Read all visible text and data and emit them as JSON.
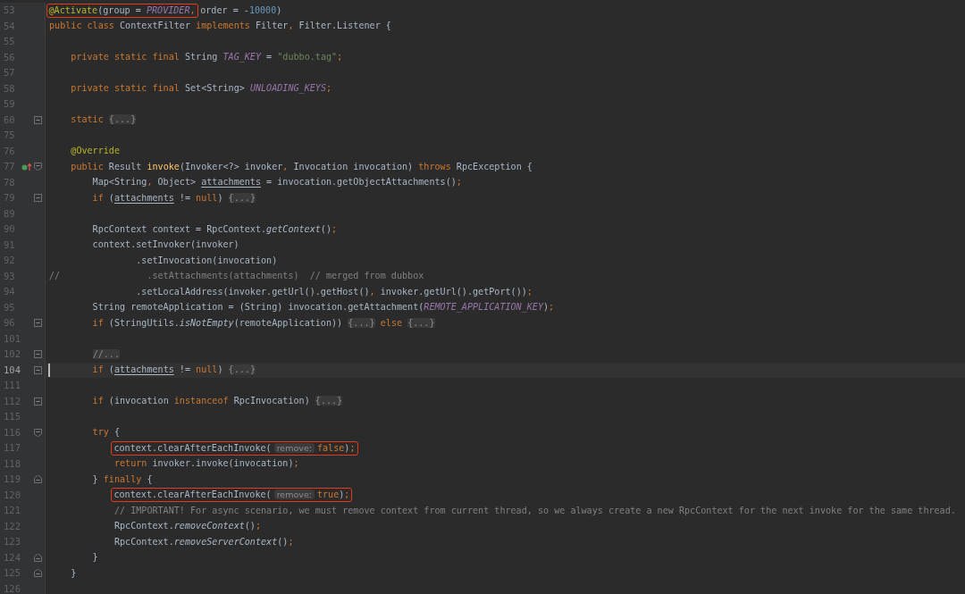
{
  "editor": {
    "lines": [
      {
        "number": "53",
        "current": false,
        "tokens": [
          {
            "text": "@Activate",
            "kind": "annotation",
            "box": true
          },
          {
            "text": "(group = ",
            "box": true
          },
          {
            "text": "PROVIDER",
            "kind": "constant",
            "box": true
          },
          {
            "text": ",",
            "kind": "keyword",
            "box": true
          },
          {
            "text": " order = -"
          },
          {
            "text": "10000",
            "kind": "number"
          },
          {
            "text": ")"
          }
        ]
      },
      {
        "number": "54",
        "current": false,
        "tokens": [
          {
            "text": "public class",
            "kind": "keyword"
          },
          {
            "text": " ContextFilter "
          },
          {
            "text": "implements",
            "kind": "keyword"
          },
          {
            "text": " Filter"
          },
          {
            "text": ",",
            "kind": "keyword"
          },
          {
            "text": " Filter.Listener {"
          }
        ]
      },
      {
        "number": "55",
        "current": false
      },
      {
        "number": "56",
        "current": false,
        "tokens": [
          {
            "text": "    private static final",
            "kind": "keyword"
          },
          {
            "text": " String "
          },
          {
            "text": "TAG_KEY",
            "kind": "constant"
          },
          {
            "text": " = "
          },
          {
            "text": "\"dubbo.tag\"",
            "kind": "string"
          },
          {
            "text": ";",
            "kind": "keyword"
          }
        ]
      },
      {
        "number": "57",
        "current": false
      },
      {
        "number": "58",
        "current": false,
        "tokens": [
          {
            "text": "    private static final",
            "kind": "keyword"
          },
          {
            "text": " Set<String> "
          },
          {
            "text": "UNLOADING_KEYS",
            "kind": "constant"
          },
          {
            "text": ";",
            "kind": "keyword"
          }
        ]
      },
      {
        "number": "59",
        "current": false
      },
      {
        "number": "60",
        "current": false,
        "fold": {
          "kind": "collapsed"
        },
        "tokens": [
          {
            "text": "    static ",
            "kind": "keyword"
          },
          {
            "text": "{...}",
            "kind": "folded"
          }
        ]
      },
      {
        "number": "75",
        "current": false
      },
      {
        "number": "76",
        "current": false,
        "tokens": [
          {
            "text": "    @Override",
            "kind": "annotation"
          }
        ]
      },
      {
        "number": "77",
        "current": false,
        "fold": {
          "kind": "open"
        },
        "gutter_icon": {
          "kind": "override"
        },
        "tokens": [
          {
            "text": "    public",
            "kind": "keyword"
          },
          {
            "text": " Result "
          },
          {
            "text": "invoke",
            "kind": "method"
          },
          {
            "text": "(Invoker<?> invoker"
          },
          {
            "text": ",",
            "kind": "keyword"
          },
          {
            "text": " Invocation invocation) "
          },
          {
            "text": "throws",
            "kind": "keyword"
          },
          {
            "text": " RpcException {"
          }
        ]
      },
      {
        "number": "78",
        "current": false,
        "tokens": [
          {
            "text": "        Map<String"
          },
          {
            "text": ",",
            "kind": "keyword"
          },
          {
            "text": " Object> "
          },
          {
            "text": "attachments",
            "kind": "field"
          },
          {
            "text": " = invocation.getObjectAttachments()"
          },
          {
            "text": ";",
            "kind": "keyword"
          }
        ]
      },
      {
        "number": "79",
        "current": false,
        "fold": {
          "kind": "collapsed"
        },
        "tokens": [
          {
            "text": "        if",
            "kind": "keyword"
          },
          {
            "text": " ("
          },
          {
            "text": "attachments",
            "kind": "field"
          },
          {
            "text": " != "
          },
          {
            "text": "null",
            "kind": "keyword"
          },
          {
            "text": ") "
          },
          {
            "text": "{...}",
            "kind": "folded"
          }
        ]
      },
      {
        "number": "89",
        "current": false
      },
      {
        "number": "90",
        "current": false,
        "tokens": [
          {
            "text": "        RpcContext context = RpcContext."
          },
          {
            "text": "getContext",
            "kind": "static"
          },
          {
            "text": "()"
          },
          {
            "text": ";",
            "kind": "keyword"
          }
        ]
      },
      {
        "number": "91",
        "current": false,
        "tokens": [
          {
            "text": "        context.setInvoker(invoker)"
          }
        ]
      },
      {
        "number": "92",
        "current": false,
        "tokens": [
          {
            "text": "                .setInvocation(invocation)"
          }
        ]
      },
      {
        "number": "93",
        "current": false,
        "tokens": [
          {
            "text": "//                .setAttachments(attachments)  // merged from dubbox",
            "kind": "comment"
          }
        ]
      },
      {
        "number": "94",
        "current": false,
        "tokens": [
          {
            "text": "                .setLocalAddress(invoker.getUrl().getHost()"
          },
          {
            "text": ",",
            "kind": "keyword"
          },
          {
            "text": " invoker.getUrl().getPort())"
          },
          {
            "text": ";",
            "kind": "keyword"
          }
        ]
      },
      {
        "number": "95",
        "current": false,
        "tokens": [
          {
            "text": "        String remoteApplication = (String) invocation.getAttachment("
          },
          {
            "text": "REMOTE_APPLICATION_KEY",
            "kind": "constant"
          },
          {
            "text": ")"
          },
          {
            "text": ";",
            "kind": "keyword"
          }
        ]
      },
      {
        "number": "96",
        "current": false,
        "fold": {
          "kind": "collapsed"
        },
        "tokens": [
          {
            "text": "        if",
            "kind": "keyword"
          },
          {
            "text": " (StringUtils."
          },
          {
            "text": "isNotEmpty",
            "kind": "static"
          },
          {
            "text": "(remoteApplication)) "
          },
          {
            "text": "{...}",
            "kind": "folded"
          },
          {
            "text": " else ",
            "kind": "keyword"
          },
          {
            "text": "{...}",
            "kind": "folded"
          }
        ]
      },
      {
        "number": "101",
        "current": false
      },
      {
        "number": "102",
        "current": false,
        "fold": {
          "kind": "collapsed"
        },
        "tokens": [
          {
            "text": "        //...",
            "kind": "folded"
          }
        ]
      },
      {
        "number": "104",
        "current": true,
        "fold": {
          "kind": "collapsed"
        },
        "tokens": [
          {
            "text": "        if",
            "kind": "keyword"
          },
          {
            "text": " ("
          },
          {
            "text": "attachments",
            "kind": "field"
          },
          {
            "text": " != "
          },
          {
            "text": "null",
            "kind": "keyword"
          },
          {
            "text": ") "
          },
          {
            "text": "{...}",
            "kind": "folded"
          }
        ]
      },
      {
        "number": "111",
        "current": false
      },
      {
        "number": "112",
        "current": false,
        "fold": {
          "kind": "collapsed"
        },
        "tokens": [
          {
            "text": "        if",
            "kind": "keyword"
          },
          {
            "text": " (invocation "
          },
          {
            "text": "instanceof",
            "kind": "keyword"
          },
          {
            "text": " RpcInvocation) "
          },
          {
            "text": "{...}",
            "kind": "folded"
          }
        ]
      },
      {
        "number": "115",
        "current": false
      },
      {
        "number": "116",
        "current": false,
        "fold": {
          "kind": "open"
        },
        "tokens": [
          {
            "text": "        try",
            "kind": "keyword"
          },
          {
            "text": " {"
          }
        ]
      },
      {
        "number": "117",
        "current": false,
        "tokens": [
          {
            "text": "            context.clearAfterEachInvoke(",
            "box": true
          },
          {
            "text": "remove:",
            "kind": "hint",
            "box": true
          },
          {
            "text": "false",
            "kind": "keyword",
            "box": true
          },
          {
            "text": ")",
            "box": true
          },
          {
            "text": ";",
            "kind": "keyword",
            "box": true
          }
        ]
      },
      {
        "number": "118",
        "current": false,
        "tokens": [
          {
            "text": "            return",
            "kind": "keyword"
          },
          {
            "text": " invoker.invoke(invocation)"
          },
          {
            "text": ";",
            "kind": "keyword"
          }
        ]
      },
      {
        "number": "119",
        "current": false,
        "fold": {
          "kind": "close"
        },
        "tokens": [
          {
            "text": "        } "
          },
          {
            "text": "finally",
            "kind": "keyword"
          },
          {
            "text": " {"
          }
        ]
      },
      {
        "number": "120",
        "current": false,
        "tokens": [
          {
            "text": "            context.clearAfterEachInvoke(",
            "box": true
          },
          {
            "text": "remove:",
            "kind": "hint",
            "box": true
          },
          {
            "text": "true",
            "kind": "keyword",
            "box": true
          },
          {
            "text": ")",
            "box": true
          },
          {
            "text": ";",
            "kind": "keyword",
            "box": true
          }
        ]
      },
      {
        "number": "121",
        "current": false,
        "tokens": [
          {
            "text": "            // IMPORTANT! For async scenario, we must remove context from current thread, so we always create a new RpcContext for the next invoke for the same thread.",
            "kind": "comment"
          }
        ]
      },
      {
        "number": "122",
        "current": false,
        "tokens": [
          {
            "text": "            RpcContext."
          },
          {
            "text": "removeContext",
            "kind": "static"
          },
          {
            "text": "()"
          },
          {
            "text": ";",
            "kind": "keyword"
          }
        ]
      },
      {
        "number": "123",
        "current": false,
        "tokens": [
          {
            "text": "            RpcContext."
          },
          {
            "text": "removeServerContext",
            "kind": "static"
          },
          {
            "text": "()"
          },
          {
            "text": ";",
            "kind": "keyword"
          }
        ]
      },
      {
        "number": "124",
        "current": false,
        "fold": {
          "kind": "close"
        },
        "tokens": [
          {
            "text": "        }"
          }
        ]
      },
      {
        "number": "125",
        "current": false,
        "fold": {
          "kind": "close"
        },
        "tokens": [
          {
            "text": "    }"
          }
        ]
      },
      {
        "number": "126",
        "current": false
      }
    ]
  }
}
